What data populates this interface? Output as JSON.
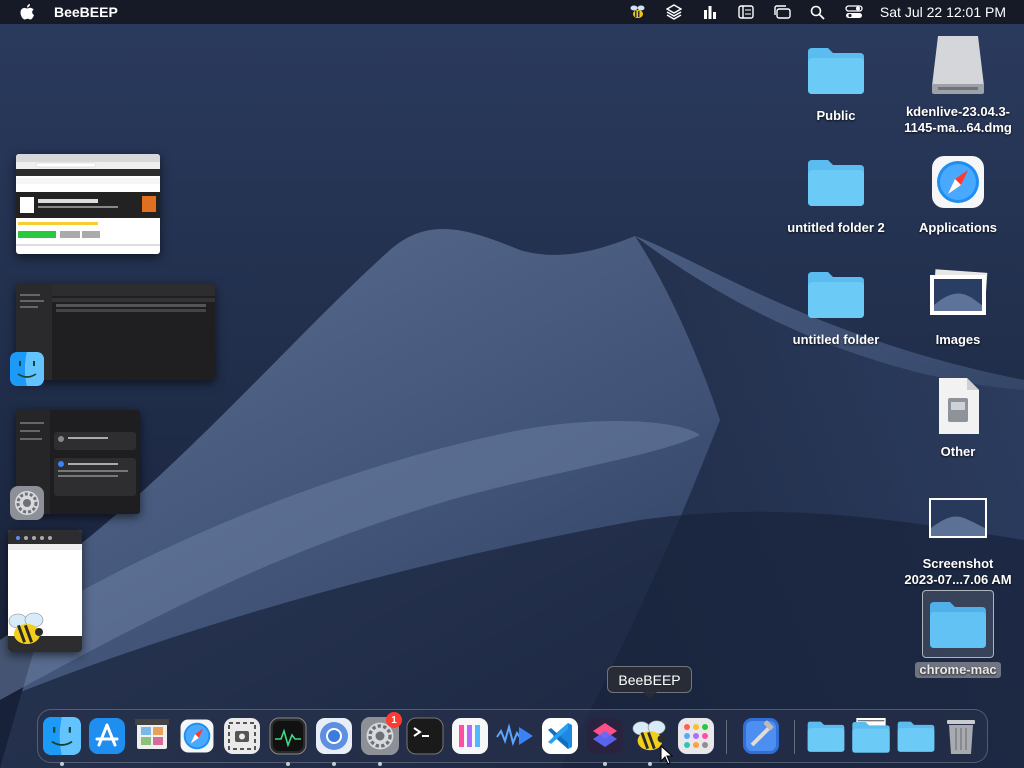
{
  "menubar": {
    "app_name": "BeeBEEP",
    "clock": "Sat Jul 22  12:01 PM",
    "status_icons": [
      "beebeep-icon",
      "layers-icon",
      "equalizer-icon",
      "sidebar-list-icon",
      "window-stack-icon",
      "search-icon",
      "control-center-icon"
    ]
  },
  "desktop": {
    "items": [
      {
        "label": "Public",
        "icon": "folder-icon"
      },
      {
        "label": "kdenlive-23.04.3-\n1145-ma...64.dmg",
        "icon": "disk-image-icon"
      },
      {
        "label": "untitled folder 2",
        "icon": "folder-icon"
      },
      {
        "label": "Applications",
        "icon": "safari-icon"
      },
      {
        "label": "untitled folder",
        "icon": "folder-icon"
      },
      {
        "label": "Images",
        "icon": "image-preview-icon"
      },
      {
        "label": "Other",
        "icon": "document-icon"
      },
      {
        "label": "Screenshot\n2023-07...7.06 AM",
        "icon": "screenshot-preview-icon"
      },
      {
        "label": "chrome-mac",
        "icon": "folder-icon"
      }
    ]
  },
  "stage_manager": {
    "groups": [
      "Web browser window",
      "Finder window",
      "System Settings window",
      "BeeBEEP window"
    ]
  },
  "dock": {
    "tooltip": "BeeBEEP",
    "badge_count": "1",
    "apps": [
      "Finder",
      "App Store",
      "Preview",
      "Safari",
      "Screenshot",
      "Activity Monitor",
      "Chromium",
      "System Settings",
      "Terminal",
      "Columns",
      "Visual Studio Code",
      "VS Code",
      "Shortcuts",
      "BeeBEEP",
      "Launchpad",
      "Xcode"
    ]
  }
}
